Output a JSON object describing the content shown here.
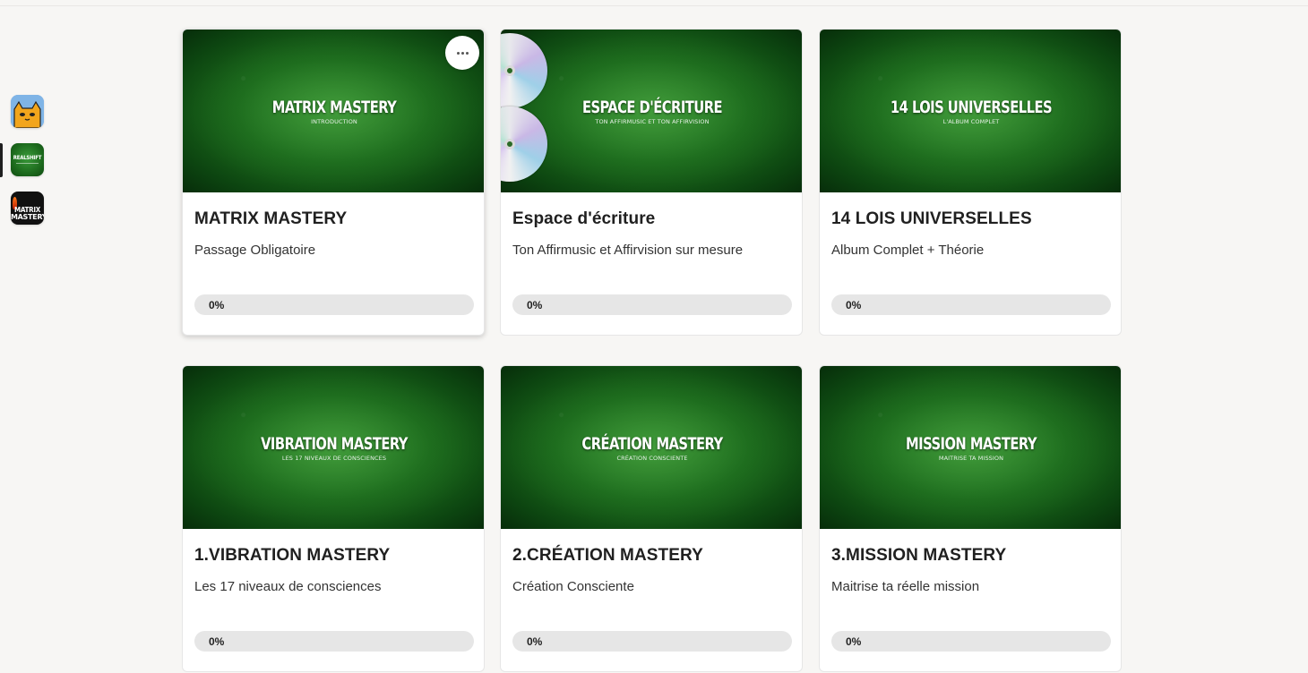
{
  "sidebar": {
    "apps": [
      {
        "name": "cat-app",
        "label": ""
      },
      {
        "name": "realshift",
        "label": "REALSHIFT"
      },
      {
        "name": "matrix-mastery",
        "label_line1": "MATRIX",
        "label_line2": "MASTERY"
      }
    ]
  },
  "courses": [
    {
      "thumb_title": "MATRIX MASTERY",
      "thumb_sub": "INTRODUCTION",
      "title": "MATRIX MASTERY",
      "description": "Passage Obligatoire",
      "progress": "0%"
    },
    {
      "thumb_title": "ESPACE D'ÉCRITURE",
      "thumb_sub": "TON AFFIRMUSIC ET TON AFFIRVISION",
      "title": "Espace d'écriture",
      "description": "Ton Affirmusic et Affirvision sur mesure",
      "progress": "0%"
    },
    {
      "thumb_title": "14 LOIS UNIVERSELLES",
      "thumb_sub": "L'ALBUM COMPLET",
      "title": "14 LOIS UNIVERSELLES",
      "description": "Album Complet + Théorie",
      "progress": "0%"
    },
    {
      "thumb_title": "VIBRATION MASTERY",
      "thumb_sub": "LES 17 NIVEAUX DE CONSCIENCES",
      "title": "1.VIBRATION MASTERY",
      "description": "Les 17 niveaux de consciences",
      "progress": "0%"
    },
    {
      "thumb_title": "CRÉATION MASTERY",
      "thumb_sub": "CRÉATION CONSCIENTE",
      "title": "2.CRÉATION MASTERY",
      "description": "Création Consciente",
      "progress": "0%"
    },
    {
      "thumb_title": "MISSION MASTERY",
      "thumb_sub": "MAITRISE TA MISSION",
      "title": "3.MISSION MASTERY",
      "description": "Maitrise ta réelle mission",
      "progress": "0%"
    }
  ],
  "colors": {
    "thumb_green": "#1c6b1c",
    "progress_track": "#e6e6e6",
    "background": "#f7f6f4"
  },
  "icons": {
    "more": "more-horizontal-icon"
  }
}
